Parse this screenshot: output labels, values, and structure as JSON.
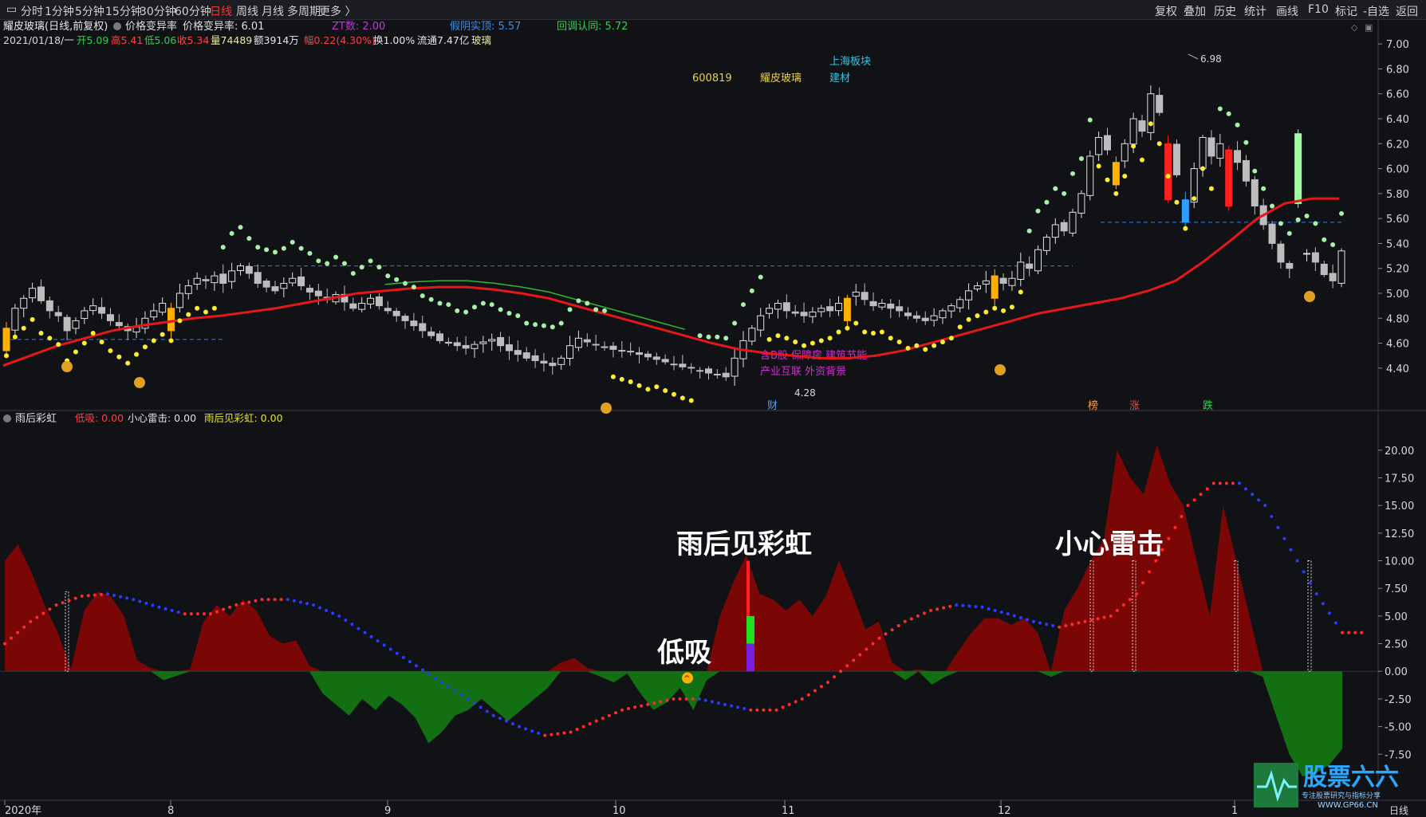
{
  "toolbar": {
    "left": [
      "分时",
      "1分钟",
      "5分钟",
      "15分钟",
      "30分钟",
      "60分钟",
      "日线",
      "周线",
      "月线",
      "多周期",
      "更多 〉"
    ],
    "active": "日线",
    "right": [
      "复权",
      "叠加",
      "历史",
      "统计",
      "画线",
      "F10",
      "标记",
      "-自选",
      "返回"
    ]
  },
  "header": {
    "title": "耀皮玻璃(日线,前复权)",
    "indicator_name": "价格变异率",
    "indicator_value": "价格变异率: 6.01",
    "zt": "ZT数: 2.00",
    "yin": "假阴实顶: 5.57",
    "hd": "回调认同: 5.72",
    "date": "2021/01/18/一",
    "open": "开5.09",
    "high": "高5.41",
    "low": "低5.06",
    "close": "收5.34",
    "vol": "量74489",
    "amt": "额3914万",
    "chg": "幅0.22(4.30%)",
    "turn": "换1.00%",
    "float": "流通7.47亿",
    "sector": "玻璃"
  },
  "info_labels": {
    "code": "600819",
    "name": "耀皮玻璃",
    "board": "上海板块",
    "industry": "建材",
    "concept1": "含B股  保障房  建筑节能",
    "concept2": "产业互联  外资背景"
  },
  "markers": {
    "cai": "财",
    "bang": "榜",
    "zhang": "涨",
    "die": "跌",
    "peak": "6.98",
    "low": "4.28"
  },
  "bottom_header": {
    "name": "雨后彩虹",
    "v1": "低吸: 0.00",
    "v2": "小心雷击: 0.00",
    "v3": "雨后见彩虹: 0.00"
  },
  "annotations": {
    "rainbow": "雨后见彩虹",
    "thunder": "小心雷击",
    "dixi": "低吸"
  },
  "time_axis": {
    "labels": [
      "2020年",
      "8",
      "9",
      "10",
      "11",
      "12",
      "1"
    ],
    "right": "日线"
  },
  "watermark": {
    "name": "股票六六",
    "site": "WWW.GP66.CN",
    "slogan": "专注股票研究与指标分享"
  },
  "chart_data": [
    {
      "type": "candlestick",
      "title": "耀皮玻璃(日线,前复权)",
      "y_ticks": [
        7.0,
        6.8,
        6.6,
        6.4,
        6.2,
        6.0,
        5.8,
        5.6,
        5.4,
        5.2,
        5.0,
        4.8,
        4.6,
        4.4
      ],
      "ylim": [
        4.22,
        7.02
      ],
      "reference_lines": [
        5.22,
        4.63,
        5.57
      ],
      "x_months": [
        "2020年",
        "8",
        "9",
        "10",
        "11",
        "12",
        "1"
      ],
      "close_approx": [
        4.72,
        4.88,
        4.96,
        5.04,
        4.94,
        4.86,
        4.82,
        4.7,
        4.78,
        4.86,
        4.9,
        4.84,
        4.78,
        4.74,
        4.7,
        4.73,
        4.8,
        4.86,
        4.92,
        4.88,
        5.0,
        5.06,
        5.12,
        5.1,
        5.14,
        5.08,
        5.18,
        5.22,
        5.16,
        5.08,
        5.05,
        5.02,
        5.08,
        5.12,
        5.06,
        5.01,
        4.98,
        4.95,
        4.99,
        4.93,
        4.88,
        4.92,
        4.96,
        4.9,
        4.86,
        4.82,
        4.78,
        4.74,
        4.7,
        4.66,
        4.62,
        4.6,
        4.58,
        4.56,
        4.59,
        4.61,
        4.63,
        4.58,
        4.54,
        4.51,
        4.48,
        4.46,
        4.44,
        4.42,
        4.48,
        4.58,
        4.64,
        4.61,
        4.59,
        4.57,
        4.55,
        4.54,
        4.53,
        4.51,
        4.49,
        4.47,
        4.45,
        4.43,
        4.41,
        4.4,
        4.38,
        4.36,
        4.35,
        4.33,
        4.48,
        4.62,
        4.72,
        4.82,
        4.88,
        4.92,
        4.86,
        4.84,
        4.82,
        4.85,
        4.88,
        4.86,
        4.92,
        4.96,
        5.01,
        4.95,
        4.9,
        4.92,
        4.88,
        4.86,
        4.82,
        4.8,
        4.78,
        4.82,
        4.86,
        4.9,
        4.95,
        5.02,
        5.06,
        5.1,
        5.14,
        5.08,
        5.12,
        5.25,
        5.2,
        5.35,
        5.45,
        5.55,
        5.5,
        5.65,
        5.8,
        6.1,
        6.25,
        6.15,
        6.05,
        6.2,
        6.4,
        6.3,
        6.6,
        6.45,
        6.2,
        5.95,
        5.75,
        6.0,
        6.25,
        6.1,
        6.2,
        6.15,
        6.05,
        5.9,
        5.7,
        5.55,
        5.4,
        5.25,
        5.2,
        5.3,
        5.32,
        5.25,
        5.15,
        5.1,
        5.34
      ],
      "ma_red_approx": [
        4.42,
        4.5,
        4.58,
        4.64,
        4.7,
        4.74,
        4.77,
        4.8,
        4.82,
        4.85,
        4.88,
        4.92,
        4.96,
        5.0,
        5.02,
        5.04,
        5.05,
        5.05,
        5.03,
        5.0,
        4.96,
        4.9,
        4.84,
        4.78,
        4.72,
        4.66,
        4.6,
        4.55,
        4.52,
        4.5,
        4.48,
        4.48,
        4.5,
        4.54,
        4.6,
        4.66,
        4.72,
        4.78,
        4.84,
        4.88,
        4.92,
        4.96,
        5.02,
        5.1,
        5.25,
        5.42,
        5.6,
        5.72,
        5.76,
        5.76
      ],
      "annotations": [
        "6.98",
        "4.28",
        "财",
        "榜",
        "涨",
        "跌"
      ]
    },
    {
      "type": "area",
      "title": "雨后彩虹",
      "y_ticks": [
        20.0,
        17.5,
        15.0,
        12.5,
        10.0,
        7.5,
        5.0,
        2.5,
        0.0,
        -2.5,
        -5.0,
        -7.5
      ],
      "ylim": [
        -9.5,
        21.5
      ],
      "histogram_approx": [
        10,
        11.5,
        9,
        6,
        3.5,
        0.2,
        5.5,
        7.2,
        6.8,
        5.0,
        1.0,
        0.3,
        -0.8,
        -0.4,
        0.2,
        4.5,
        6.0,
        5.0,
        6.5,
        5.5,
        3.2,
        2.5,
        2.8,
        0.5,
        -2.0,
        -3.0,
        -4.0,
        -2.5,
        -3.5,
        -2.2,
        -3.0,
        -4.2,
        -6.5,
        -5.5,
        -4.0,
        -3.5,
        -2.5,
        -3.5,
        -4.5,
        -3.5,
        -2.5,
        -1.5,
        0.8,
        1.2,
        0.3,
        -0.5,
        -1.0,
        -0.2,
        -2.0,
        -3.5,
        -2.8,
        -1.5,
        -3.5,
        -0.8,
        5.0,
        8.0,
        10.5,
        7.0,
        6.5,
        5.5,
        6.5,
        5.0,
        6.8,
        10.0,
        7.0,
        3.8,
        4.5,
        0.8,
        -0.8,
        0.2,
        -1.2,
        -0.5,
        1.8,
        3.5,
        4.8,
        4.8,
        4.2,
        4.8,
        3.5,
        -0.5,
        5.5,
        7.5,
        10.0,
        12.0,
        20.0,
        17.5,
        16.0,
        20.5,
        17.0,
        15.0,
        10.0,
        5.0,
        15.0,
        10.0,
        5.0,
        -0.5,
        -4.0,
        -7.5,
        -9.5,
        -9.2,
        -8.5,
        -7.0
      ],
      "dots_approx": [
        2.5,
        4.5,
        6.0,
        6.8,
        7.0,
        6.5,
        5.8,
        5.2,
        5.2,
        6.0,
        6.5,
        6.5,
        6.0,
        5.0,
        3.5,
        2.0,
        0.5,
        -1.0,
        -2.5,
        -4.0,
        -5.0,
        -5.8,
        -5.5,
        -4.5,
        -3.5,
        -3.0,
        -2.5,
        -2.5,
        -3.0,
        -3.5,
        -3.5,
        -2.5,
        -1.0,
        1.0,
        3.0,
        4.5,
        5.5,
        6.0,
        5.8,
        5.2,
        4.5,
        4.0,
        4.5,
        5.0,
        7.0,
        11.0,
        15.0,
        17.0,
        17.0,
        15.0,
        11.0,
        7.0,
        3.5
      ],
      "signals": [
        "低吸",
        "雨后见彩虹",
        "小心雷击"
      ]
    }
  ]
}
